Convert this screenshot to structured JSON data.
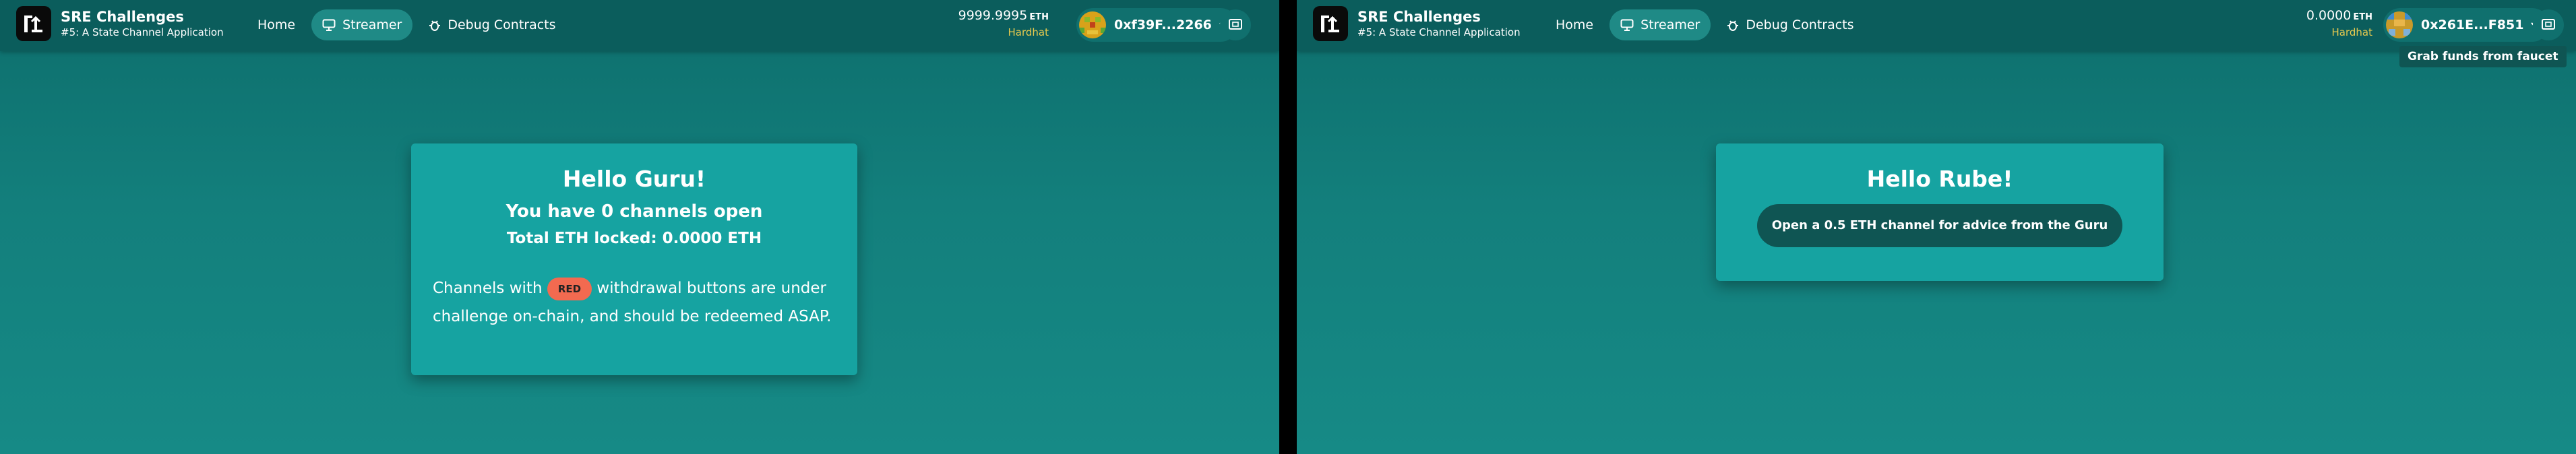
{
  "colors": {
    "background": "#137f7c",
    "navbar": "#0b5d5c",
    "card": "#16a3a1",
    "badge_red": "#f26a50",
    "network": "#e6c94e"
  },
  "left": {
    "brand": {
      "title": "SRE Challenges",
      "subtitle": "#5: A State Channel Application"
    },
    "nav": {
      "home": "Home",
      "streamer": "Streamer",
      "debug": "Debug Contracts"
    },
    "balance": {
      "value": "9999.9995",
      "unit": "ETH",
      "network": "Hardhat"
    },
    "account": {
      "address": "0xf39F...2266"
    },
    "card": {
      "greeting": "Hello Guru!",
      "channels": "You have 0 channels open",
      "locked": "Total ETH locked: 0.0000 ETH",
      "para_before": "Channels with",
      "badge": "RED",
      "para_after": "withdrawal buttons are under challenge on-chain, and should be redeemed ASAP."
    }
  },
  "right": {
    "brand": {
      "title": "SRE Challenges",
      "subtitle": "#5: A State Channel Application"
    },
    "nav": {
      "home": "Home",
      "streamer": "Streamer",
      "debug": "Debug Contracts"
    },
    "balance": {
      "value": "0.0000",
      "unit": "ETH",
      "network": "Hardhat"
    },
    "account": {
      "address": "0x261E...F851"
    },
    "tooltip": "Grab funds from faucet",
    "card": {
      "greeting": "Hello Rube!",
      "button": "Open a 0.5 ETH channel for advice from the Guru"
    }
  }
}
